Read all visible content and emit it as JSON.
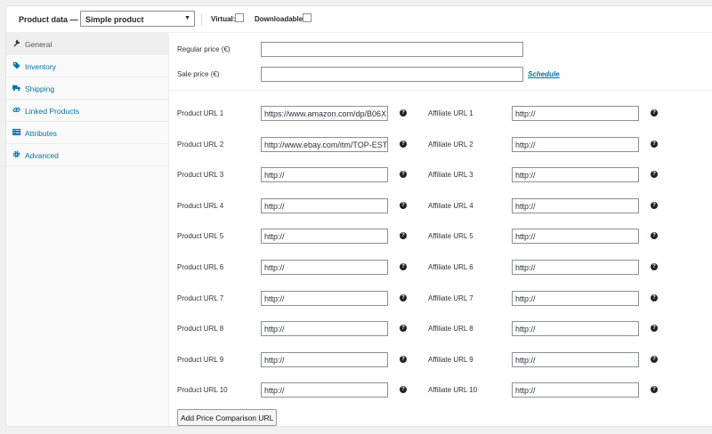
{
  "header": {
    "title": "Product data —",
    "product_type": "Simple product",
    "virtual_label": "Virtual:",
    "downloadable_label": "Downloadable:"
  },
  "tabs": [
    {
      "label": "General",
      "icon": "wrench-icon"
    },
    {
      "label": "Inventory",
      "icon": "tag-icon"
    },
    {
      "label": "Shipping",
      "icon": "truck-icon"
    },
    {
      "label": "Linked Products",
      "icon": "link-icon"
    },
    {
      "label": "Attributes",
      "icon": "list-icon"
    },
    {
      "label": "Advanced",
      "icon": "gear-icon"
    }
  ],
  "pricing": {
    "regular_label": "Regular price (€)",
    "regular_value": "",
    "sale_label": "Sale price (€)",
    "sale_value": "",
    "schedule_link": "Schedule"
  },
  "rows": [
    {
      "product_label": "Product URL 1",
      "product_value": "https://www.amazon.com/dp/B06X",
      "affiliate_label": "Affiliate URL 1",
      "affiliate_value": "http://"
    },
    {
      "product_label": "Product URL 2",
      "product_value": "http://www.ebay.com/itm/TOP-EST",
      "affiliate_label": "Affiliate URL 2",
      "affiliate_value": "http://"
    },
    {
      "product_label": "Product URL 3",
      "product_value": "http://",
      "affiliate_label": "Affiliate URL 3",
      "affiliate_value": "http://"
    },
    {
      "product_label": "Product URL 4",
      "product_value": "http://",
      "affiliate_label": "Affiliate URL 4",
      "affiliate_value": "http://"
    },
    {
      "product_label": "Product URL 5",
      "product_value": "http://",
      "affiliate_label": "Affiliate URL 5",
      "affiliate_value": "http://"
    },
    {
      "product_label": "Product URL 6",
      "product_value": "http://",
      "affiliate_label": "Affiliate URL 6",
      "affiliate_value": "http://"
    },
    {
      "product_label": "Product URL 7",
      "product_value": "http://",
      "affiliate_label": "Affiliate URL 7",
      "affiliate_value": "http://"
    },
    {
      "product_label": "Product URL 8",
      "product_value": "http://",
      "affiliate_label": "Affiliate URL 8",
      "affiliate_value": "http://"
    },
    {
      "product_label": "Product URL 9",
      "product_value": "http://",
      "affiliate_label": "Affiliate URL 9",
      "affiliate_value": "http://"
    },
    {
      "product_label": "Product URL 10",
      "product_value": "http://",
      "affiliate_label": "Affiliate URL 10",
      "affiliate_value": "http://"
    }
  ],
  "help_glyph": "?",
  "add_button": "Add Price Comparison URL"
}
